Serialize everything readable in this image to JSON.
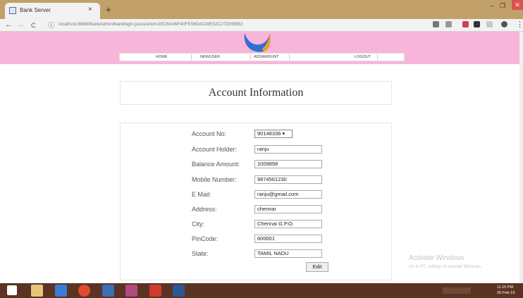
{
  "browser": {
    "tab_title": "Bank Server",
    "tab_close": "×",
    "new_tab": "+",
    "url": "localhost:8888/BankAdmin/banklogin;jsessionid=2EC6A06F40FE560A028E52C27D09EB2",
    "win_minimize": "–",
    "win_restore": "❐",
    "win_close": "✕",
    "nav_back": "←",
    "nav_forward": "→",
    "nav_reload": "C",
    "info_icon": "ⓘ",
    "menu_icon": "⋮"
  },
  "nav": {
    "items": [
      "HOME",
      "NEWUSER",
      "ADDAMOUNT",
      "LOGOUT"
    ]
  },
  "page": {
    "title": "Account Information"
  },
  "form": {
    "account_no_label": "Account No:",
    "account_no_value": "90148336 ▾",
    "fields": [
      {
        "label": "Account Holder:",
        "value": "ranju"
      },
      {
        "label": "Balance Amount:",
        "value": "1009858"
      },
      {
        "label": "Mobile Number:",
        "value": "9874561230"
      },
      {
        "label": "E Mail:",
        "value": "ranju@gmail.com"
      },
      {
        "label": "Address:",
        "value": "chennai"
      },
      {
        "label": "City:",
        "value": "Chennai G.P.O."
      },
      {
        "label": "PinCode:",
        "value": "600001"
      },
      {
        "label": "State:",
        "value": "TAMIL NADU"
      }
    ],
    "edit_label": "Edit"
  },
  "watermark": {
    "line1": "Activate Windows",
    "line2": "Go to PC settings to activate Windows."
  },
  "taskbar": {
    "time": "11:15 PM",
    "date": "26-Feb-19"
  },
  "colors": {
    "header_pink": "#f7b6d9",
    "tabstrip": "#c2a069",
    "taskbar": "#5a3322"
  }
}
